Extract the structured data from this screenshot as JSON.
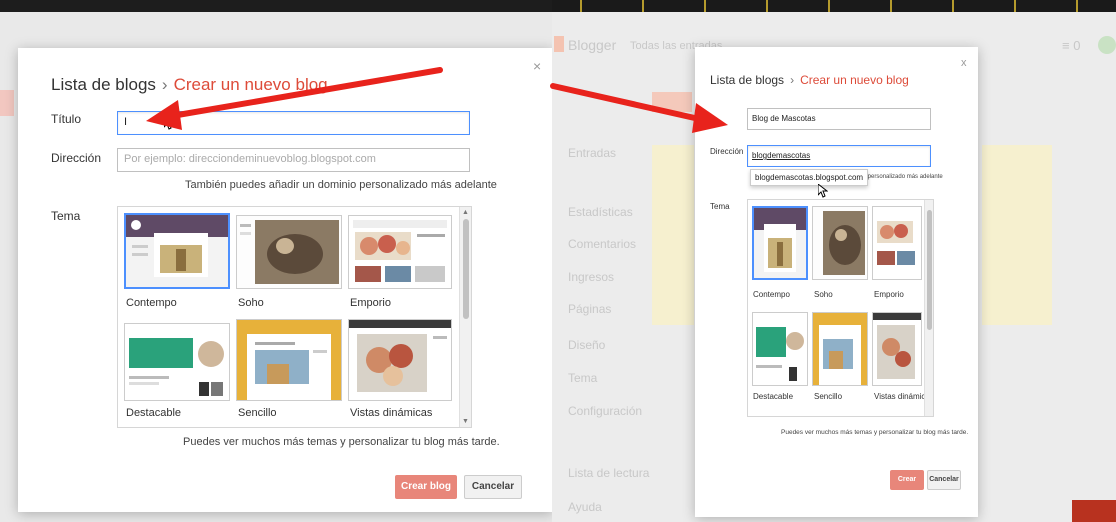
{
  "left": {
    "breadcrumb_root": "Lista de blogs",
    "breadcrumb_sep": "›",
    "breadcrumb_current": "Crear un nuevo blog",
    "close": "×",
    "title_label": "Título",
    "title_value": "I",
    "address_label": "Dirección",
    "address_placeholder": "Por ejemplo: direcciondeminuevoblog.blogspot.com",
    "address_hint": "También puedes añadir un dominio personalizado más adelante",
    "theme_label": "Tema",
    "themes": [
      "Contempo",
      "Soho",
      "Emporio",
      "Destacable",
      "Sencillo",
      "Vistas dinámicas"
    ],
    "themes_hint": "Puedes ver muchos más temas y personalizar tu blog más tarde.",
    "create_button": "Crear blog",
    "cancel_button": "Cancelar"
  },
  "right": {
    "app_name": "Blogger",
    "header_tab": "Todas las entradas",
    "breadcrumb_root": "Lista de blogs",
    "breadcrumb_sep": "›",
    "breadcrumb_current": "Crear un nuevo blog",
    "close": "x",
    "title_value": "Blog de Mascotas",
    "address_label": "Dirección",
    "address_value": "blogdemascotas",
    "suggestion": "blogdemascotas.blogspot.com",
    "address_hint": "dominio personalizado más adelante",
    "theme_label": "Tema",
    "themes": [
      "Contempo",
      "Soho",
      "Emporio",
      "Destacable",
      "Sencillo",
      "Vistas dinámicas"
    ],
    "themes_hint": "Puedes ver muchos más temas y personalizar tu blog más tarde.",
    "create_button": "Crear blog",
    "cancel_button": "Cancelar",
    "sidebar": [
      "Entradas",
      "Estadísticas",
      "Comentarios",
      "Ingresos",
      "Páginas",
      "Diseño",
      "Tema",
      "Configuración",
      "Lista de lectura",
      "Ayuda"
    ]
  },
  "colors": {
    "accent_red": "#dd4b39",
    "focus_blue": "#4d90fe",
    "arrow_red": "#e8231c",
    "button_primary": "#e8867a"
  }
}
